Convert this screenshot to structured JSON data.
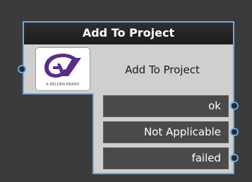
{
  "node": {
    "title": "Add To Project",
    "label": "Add To Project",
    "logo_caption": "A BELDEN BRAND",
    "logo_icon": "gv-logo-icon",
    "input_port_icon": "input-port-icon",
    "output_port_icon": "output-port-icon",
    "outputs": [
      {
        "label": "ok"
      },
      {
        "label": "Not Applicable"
      },
      {
        "label": "failed"
      }
    ]
  },
  "colors": {
    "canvas": "#3b3b3b",
    "node_body": "#cfcfcf",
    "node_border": "#6aa8e8",
    "title_bar": "#1c1c1c",
    "output_row": "#4a4a4a",
    "logo_purple": "#5a2d8a"
  }
}
